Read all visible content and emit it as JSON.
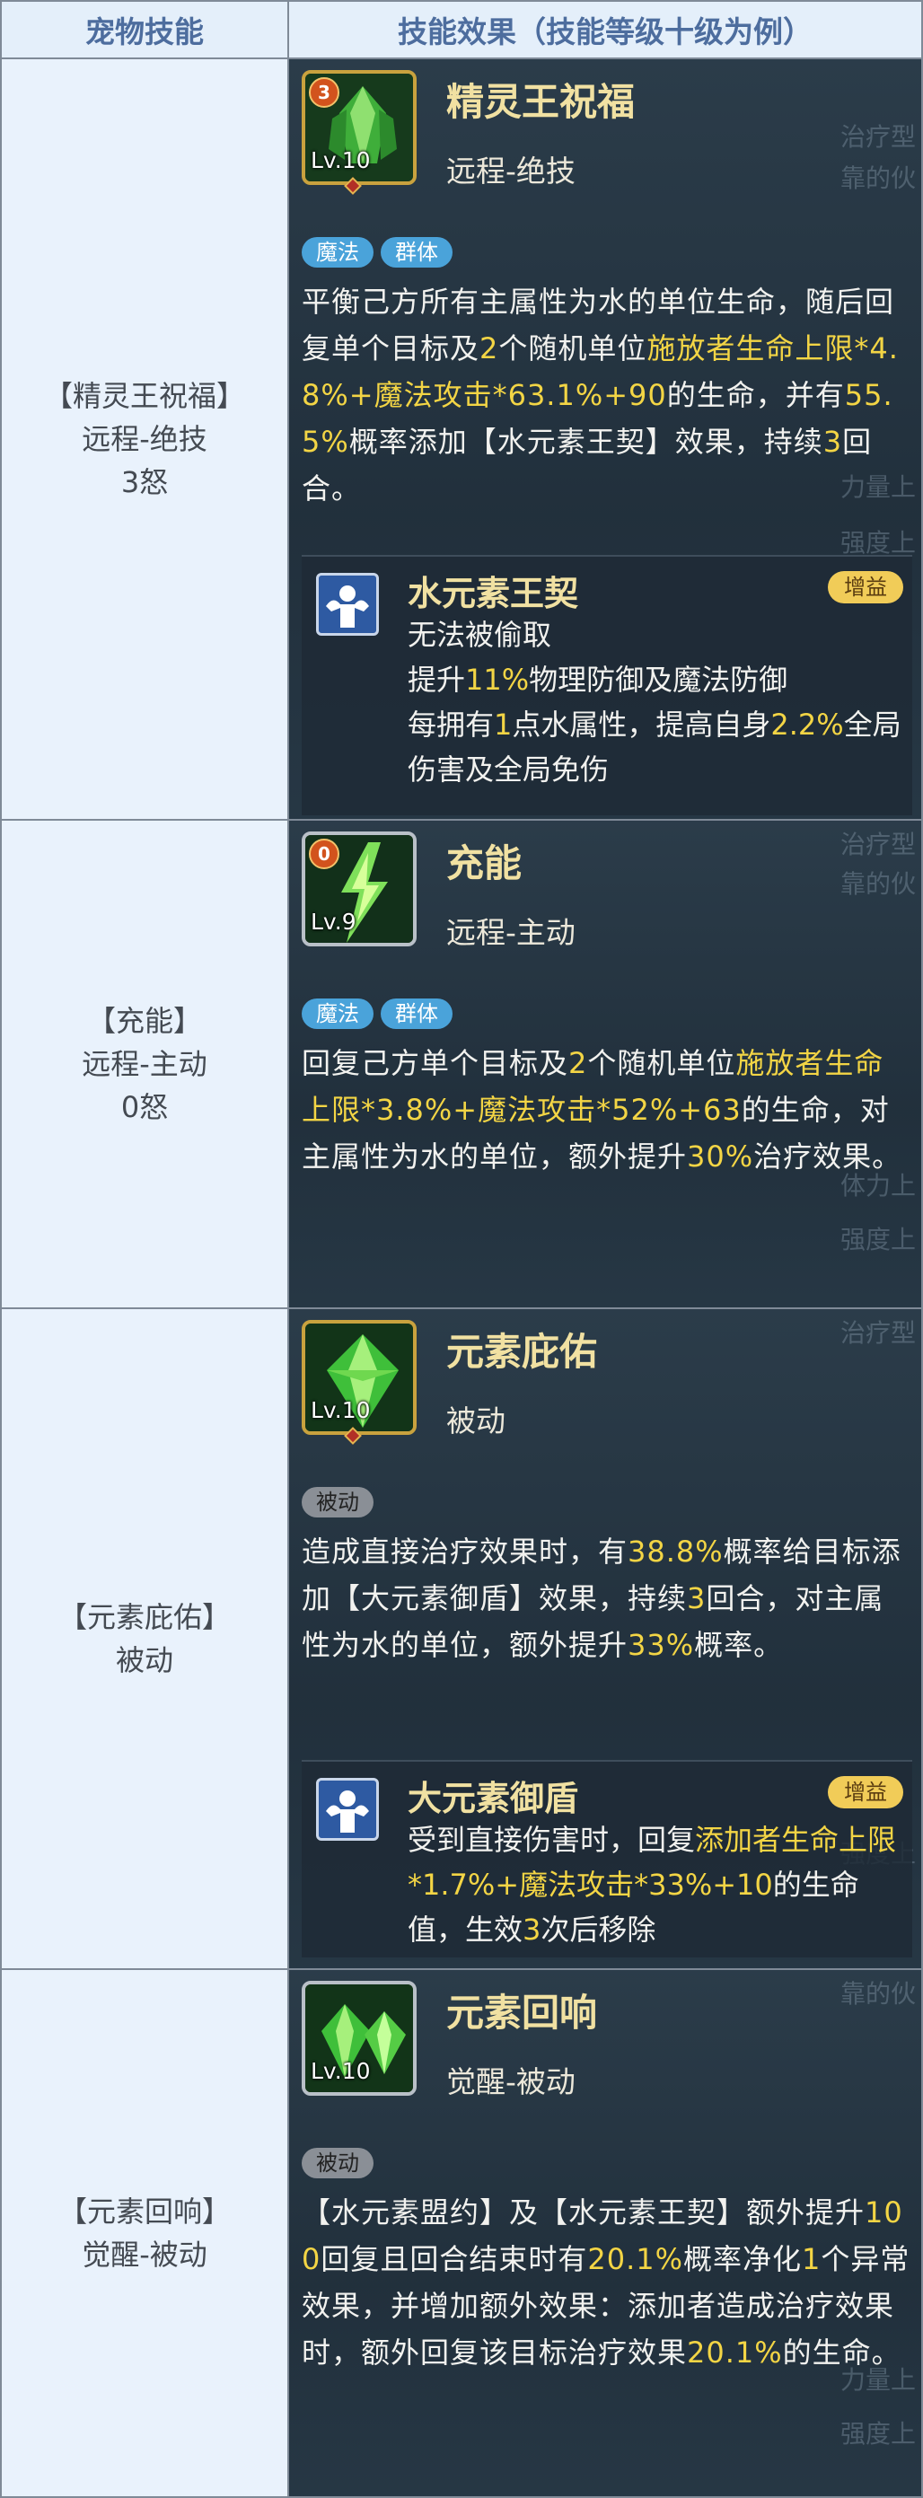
{
  "header": {
    "col1": "宠物技能",
    "col2": "技能效果（技能等级十级为例）"
  },
  "colors": {
    "highlight": "#f3d545",
    "tag_blue": "#4aa3da",
    "tag_gray": "#8a8f96",
    "buff_tag": "#f1cc58"
  },
  "rows": [
    {
      "left": {
        "line1": "【精灵王祝福】",
        "line2": "远程-绝技",
        "line3": "3怒"
      },
      "skill": {
        "icon": "green-crystal-king-icon",
        "cost": "3",
        "level": "Lv.10",
        "name": "精灵王祝福",
        "type": "远程-绝技",
        "tags": [
          "魔法",
          "群体"
        ],
        "desc": {
          "p1": "平衡己方所有主属性为水的单位生命，随后回复单个目标及",
          "n1": "2",
          "p2": "个随机单位",
          "h1": "施放者生命上限*4.8%+魔法攻击*63.1%+90",
          "p3": "的生命，并有",
          "h2": "55.5%",
          "p4": "概率添加【水元素王契】效果，持续",
          "n2": "3",
          "p5": "回合。"
        },
        "buff": {
          "icon": "muscle-buff-icon",
          "name": "水元素王契",
          "tag": "增益",
          "l1": "无法被偷取",
          "l2a": "提升",
          "l2h": "11%",
          "l2b": "物理防御及魔法防御",
          "l3a": "每拥有",
          "l3n": "1",
          "l3b": "点水属性，提高自身",
          "l3h": "2.2%",
          "l3c": "全局伤害及全局免伤"
        }
      }
    },
    {
      "left": {
        "line1": "【充能】",
        "line2": "远程-主动",
        "line3": "0怒"
      },
      "skill": {
        "icon": "green-lightning-icon",
        "cost": "0",
        "level": "Lv.9",
        "name": "充能",
        "type": "远程-主动",
        "tags": [
          "魔法",
          "群体"
        ],
        "desc": {
          "p1": "回复己方单个目标及",
          "n1": "2",
          "p2": "个随机单位",
          "h1": "施放者生命上限*3.8%+魔法攻击*52%+63",
          "p3": "的生命，对主属性为水的单位，额外提升",
          "h2": "30%",
          "p4": "治疗效果。"
        }
      }
    },
    {
      "left": {
        "line1": "【元素庇佑】",
        "line2": "被动"
      },
      "skill": {
        "icon": "green-gem-icon",
        "level": "Lv.10",
        "name": "元素庇佑",
        "type": "被动",
        "tags": [
          "被动"
        ],
        "desc": {
          "p1": "造成直接治疗效果时，有",
          "h1": "38.8%",
          "p2": "概率给目标添加【大元素御盾】效果，持续",
          "n1": "3",
          "p3": "回合，对主属性为水的单位，额外提升",
          "h2": "33%",
          "p4": "概率。"
        },
        "buff": {
          "icon": "muscle-buff-icon",
          "name": "大元素御盾",
          "tag": "增益",
          "l1a": "受到直接伤害时，回复",
          "l1h": "添加者生命上限*1.7%+魔法攻击*33%+10",
          "l1b": "的生命值，生效",
          "l1n": "3",
          "l1c": "次后移除"
        }
      }
    },
    {
      "left": {
        "line1": "【元素回响】",
        "line2": "觉醒-被动"
      },
      "skill": {
        "icon": "twin-gem-icon",
        "level": "Lv.10",
        "name": "元素回响",
        "type": "觉醒-被动",
        "tags": [
          "被动"
        ],
        "desc": {
          "p1": "【水元素盟约】及【水元素王契】额外提升",
          "n1": "100",
          "p2": "回复且回合结束时有",
          "h1": "20.1%",
          "p3": "概率净化",
          "n2": "1",
          "p4": "个异常效果，并增加额外效果：添加者造成治疗效果时，额外回复该目标治疗效果",
          "h2": "20.1%",
          "p5": "的生命。"
        }
      }
    }
  ],
  "ghost_text": [
    "靠的伙",
    "治疗型",
    "力量上",
    "强度上",
    "体力上"
  ]
}
